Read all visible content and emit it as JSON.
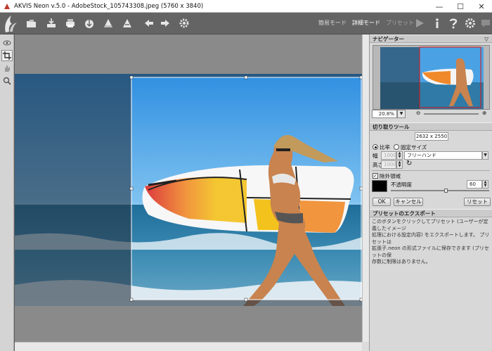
{
  "window": {
    "title": "AKVIS Neon v.5.0 - AdobeStock_105743308.jpeg (5760 x 3840)",
    "minimize": "—",
    "maximize": "☐",
    "close": "✕"
  },
  "toolbar": {
    "modes": {
      "easy": "簡易モード",
      "advanced": "詳細モード",
      "presets": "プリセット"
    },
    "icons": [
      "open-icon",
      "save-icon",
      "print-icon",
      "share-icon",
      "import-icon",
      "export-icon",
      "undo-icon",
      "redo-icon",
      "settings-gear-icon",
      "run-icon",
      "info-icon",
      "help-icon",
      "preferences-icon",
      "notifications-icon"
    ]
  },
  "navigator": {
    "title": "ナビゲーター",
    "zoom": "20.8%"
  },
  "crop": {
    "title": "切り取りツール",
    "size": "2632 x 2550",
    "ratio_label": "比率",
    "fixed_label": "固定サイズ",
    "width_label": "幅",
    "width_value": "1000",
    "height_label": "高さ",
    "height_value": "1000",
    "mode_value": "フリーハンド",
    "exclude_label": "除外領域",
    "opacity_label": "不透明度",
    "opacity_value": "60",
    "ok": "OK",
    "cancel": "キャンセル",
    "reset": "リセット"
  },
  "preset_export": {
    "title": "プリセットのエクスポート",
    "desc_1": "このボタンをクリックしてプリセット (ユーザーが定義したイメージ",
    "desc_2": "処理における設定内容) をエクスポートします。 プリセットは",
    "desc_3": "拡張子.neon の形式ファイルに保存できます (プリセットの保",
    "desc_4": "存数に制限はありません。"
  }
}
